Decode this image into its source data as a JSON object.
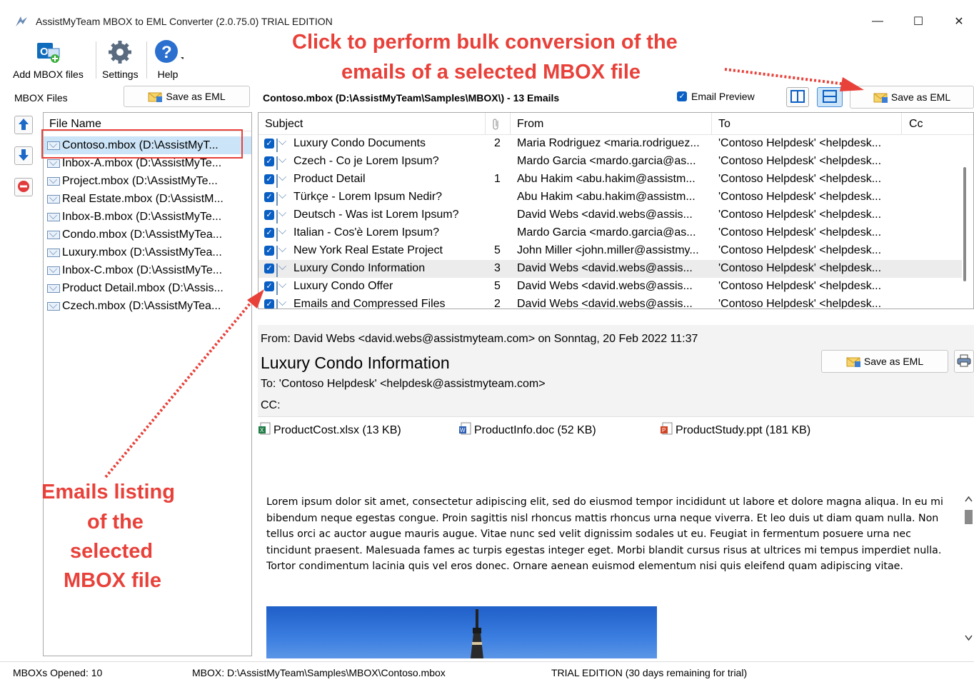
{
  "window": {
    "title": "AssistMyTeam MBOX to EML Converter (2.0.75.0) TRIAL EDITION",
    "minimize": "—",
    "maximize": "☐",
    "close": "✕"
  },
  "toolbar": {
    "add_label": "Add MBOX files",
    "settings_label": "Settings",
    "help_label": "Help"
  },
  "left_pane": {
    "header": "MBOX Files",
    "save_button": "Save as EML",
    "column_header": "File Name",
    "files": [
      "Contoso.mbox (D:\\AssistMyT...",
      "Inbox-A.mbox (D:\\AssistMyTe...",
      "Project.mbox (D:\\AssistMyTe...",
      "Real Estate.mbox (D:\\AssistM...",
      "Inbox-B.mbox (D:\\AssistMyTe...",
      "Condo.mbox (D:\\AssistMyTea...",
      "Luxury.mbox (D:\\AssistMyTea...",
      "Inbox-C.mbox (D:\\AssistMyTe...",
      "Product Detail.mbox (D:\\Assis...",
      "Czech.mbox (D:\\AssistMyTea..."
    ]
  },
  "email_list": {
    "header": "Contoso.mbox (D:\\AssistMyTeam\\Samples\\MBOX\\) - 13 Emails",
    "preview_checkbox_label": "Email Preview",
    "save_button": "Save as EML",
    "columns": {
      "subject": "Subject",
      "from": "From",
      "to": "To",
      "cc": "Cc"
    },
    "rows": [
      {
        "subject": "Luxury Condo Documents",
        "att": "2",
        "from": "Maria Rodriguez <maria.rodriguez...",
        "to": "'Contoso Helpdesk' <helpdesk..."
      },
      {
        "subject": "Czech - Co je Lorem Ipsum?",
        "att": "",
        "from": "Mardo Garcia <mardo.garcia@as...",
        "to": "'Contoso Helpdesk' <helpdesk..."
      },
      {
        "subject": "Product Detail",
        "att": "1",
        "from": "Abu Hakim <abu.hakim@assistm...",
        "to": "'Contoso Helpdesk' <helpdesk..."
      },
      {
        "subject": "Türkçe - Lorem Ipsum Nedir?",
        "att": "",
        "from": "Abu Hakim <abu.hakim@assistm...",
        "to": "'Contoso Helpdesk' <helpdesk..."
      },
      {
        "subject": "Deutsch - Was ist Lorem Ipsum?",
        "att": "",
        "from": "David Webs <david.webs@assis...",
        "to": "'Contoso Helpdesk' <helpdesk..."
      },
      {
        "subject": "Italian - Cos'è Lorem Ipsum?",
        "att": "",
        "from": "Mardo Garcia <mardo.garcia@as...",
        "to": "'Contoso Helpdesk' <helpdesk..."
      },
      {
        "subject": "New York Real Estate Project",
        "att": "5",
        "from": "John Miller <john.miller@assistmy...",
        "to": "'Contoso Helpdesk' <helpdesk..."
      },
      {
        "subject": "Luxury Condo Information",
        "att": "3",
        "from": "David Webs <david.webs@assis...",
        "to": "'Contoso Helpdesk' <helpdesk..."
      },
      {
        "subject": "Luxury Condo Offer",
        "att": "5",
        "from": "David Webs <david.webs@assis...",
        "to": "'Contoso Helpdesk' <helpdesk..."
      },
      {
        "subject": "Emails and Compressed Files",
        "att": "2",
        "from": "David Webs <david.webs@assis...",
        "to": "'Contoso Helpdesk' <helpdesk..."
      }
    ]
  },
  "preview": {
    "from_line": "From: David Webs <david.webs@assistmyteam.com> on Sonntag, 20 Feb 2022 11:37",
    "subject": "Luxury Condo Information",
    "save_button": "Save as EML",
    "to_line": "To: 'Contoso Helpdesk' <helpdesk@assistmyteam.com>",
    "cc_line": "CC:",
    "attachments": [
      "ProductCost.xlsx (13 KB)",
      "ProductInfo.doc (52 KB)",
      "ProductStudy.ppt (181 KB)"
    ],
    "body": "Lorem ipsum dolor sit amet, consectetur adipiscing elit, sed do eiusmod tempor incididunt ut labore et dolore magna aliqua. In eu mi bibendum neque egestas congue. Proin sagittis nisl rhoncus mattis rhoncus urna neque viverra. Et leo duis ut diam quam nulla. Non tellus orci ac auctor augue mauris augue. Vitae nunc sed velit dignissim sodales ut eu. Feugiat in fermentum posuere urna nec tincidunt praesent. Malesuada fames ac turpis egestas integer eget. Morbi blandit cursus risus at ultrices mi tempus imperdiet nulla. Tortor condimentum lacinia quis vel eros donec. Ornare aenean euismod elementum nisi quis eleifend quam adipiscing vitae."
  },
  "annotations": {
    "top_line1": "Click to perform bulk conversion of the",
    "top_line2": "emails of a selected MBOX file",
    "left_line1": "Emails listing",
    "left_line2": "of the",
    "left_line3": "selected",
    "left_line4": "MBOX file"
  },
  "status_bar": {
    "opened": "MBOXs Opened: 10",
    "path": "MBOX: D:\\AssistMyTeam\\Samples\\MBOX\\Contoso.mbox",
    "trial": "TRIAL EDITION (30 days remaining for trial)"
  },
  "colors": {
    "accent": "#0a5fc4",
    "annotation": "#e8413a",
    "selection": "#cce4f7"
  }
}
